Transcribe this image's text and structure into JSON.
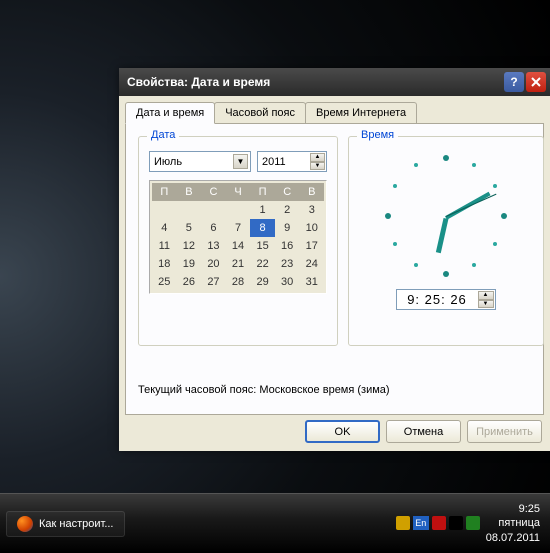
{
  "dialog": {
    "title": "Свойства: Дата и время",
    "tabs": [
      "Дата и время",
      "Часовой пояс",
      "Время Интернета"
    ],
    "date_group_label": "Дата",
    "time_group_label": "Время",
    "month": "Июль",
    "year": "2011",
    "weekday_headers": [
      "П",
      "В",
      "С",
      "Ч",
      "П",
      "С",
      "В"
    ],
    "calendar_weeks": [
      [
        null,
        null,
        null,
        null,
        1,
        2,
        3
      ],
      [
        4,
        5,
        6,
        7,
        8,
        9,
        10
      ],
      [
        11,
        12,
        13,
        14,
        15,
        16,
        17
      ],
      [
        18,
        19,
        20,
        21,
        22,
        23,
        24
      ],
      [
        25,
        26,
        27,
        28,
        29,
        30,
        31
      ]
    ],
    "selected_day": 8,
    "time_value": "9: 25: 26",
    "timezone_text": "Текущий часовой пояс: Московское время (зима)",
    "ok_label": "OK",
    "cancel_label": "Отмена",
    "apply_label": "Применить"
  },
  "taskbar": {
    "app_label": "Как настроит...",
    "lang": "En",
    "clock_time": "9:25",
    "clock_weekday": "пятница",
    "clock_date": "08.07.2011"
  },
  "clock_hands": {
    "hour_deg": 192.7,
    "min_deg": 60.6,
    "sec_deg": 66
  }
}
